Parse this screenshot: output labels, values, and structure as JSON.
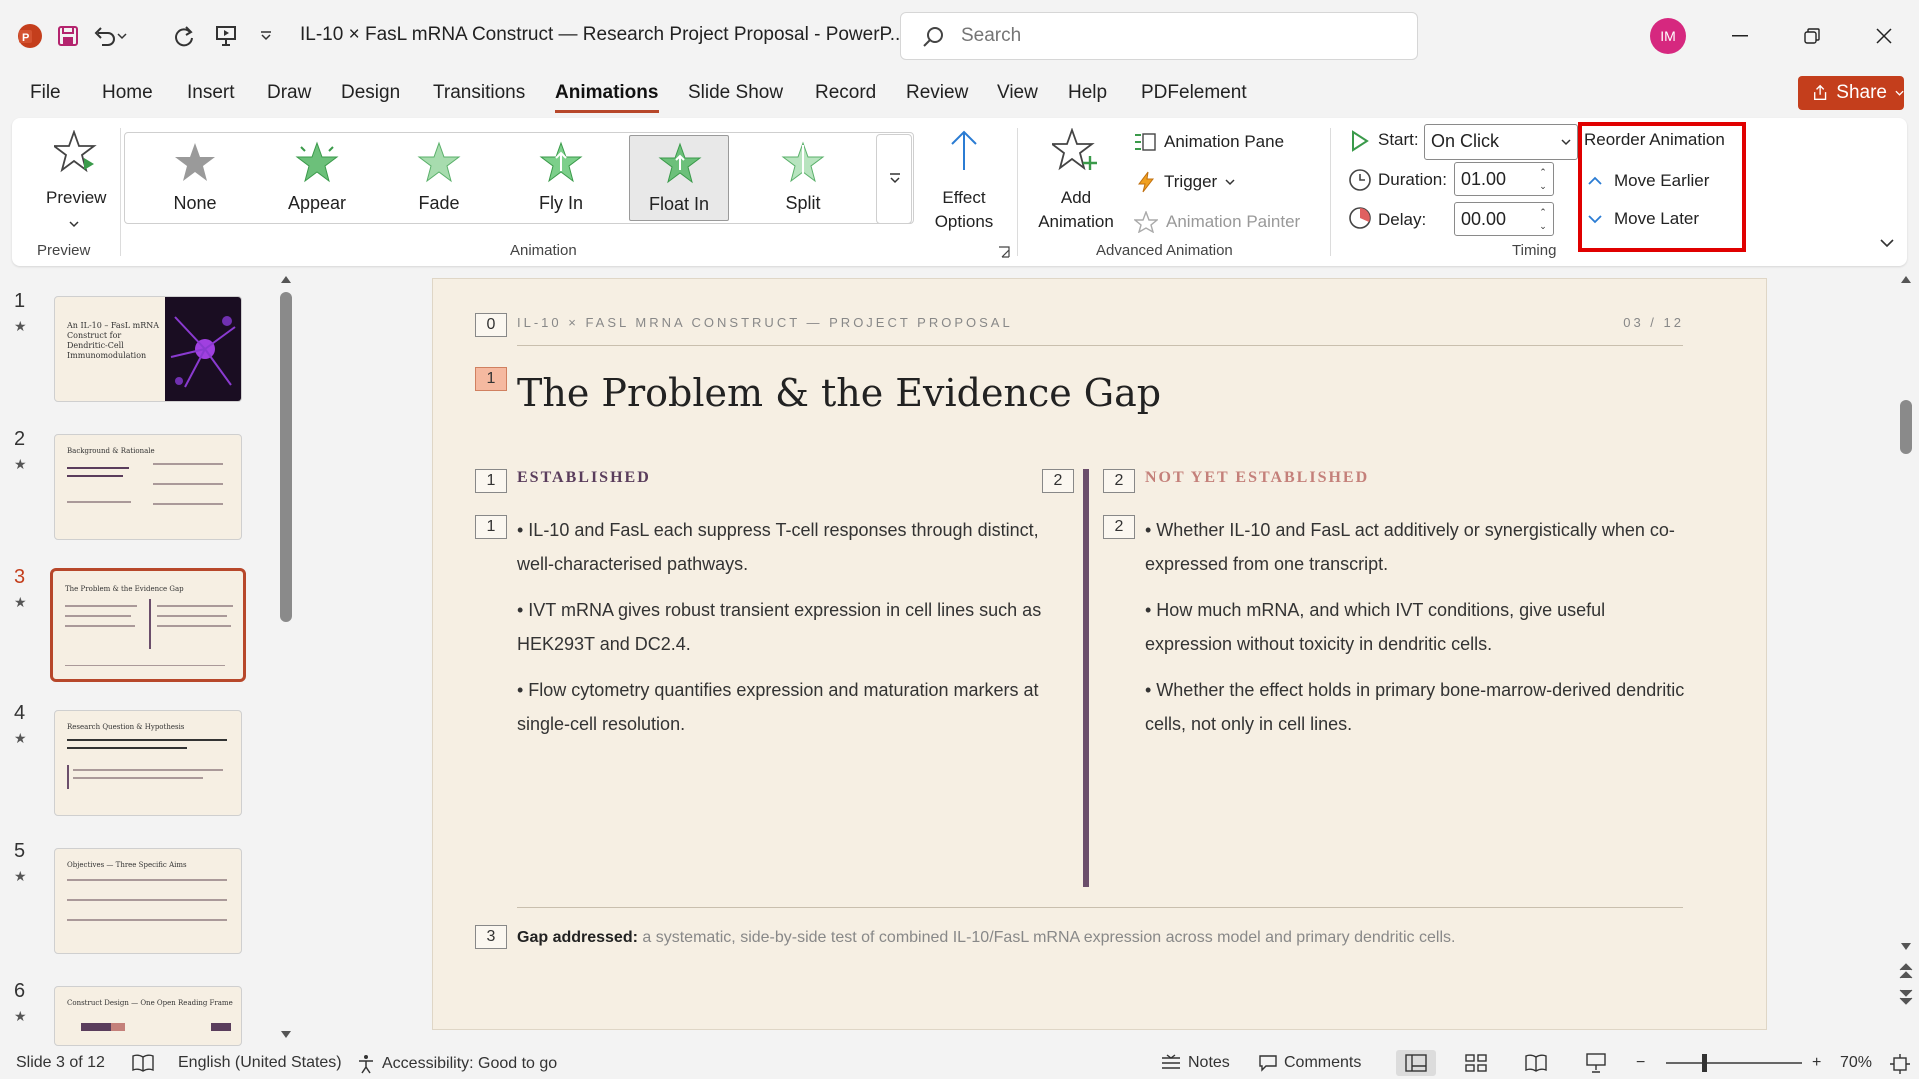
{
  "titlebar": {
    "doc_title": "IL-10 × FasL mRNA Construct — Research Project Proposal  -  PowerP...",
    "search_placeholder": "Search",
    "avatar_initials": "IM"
  },
  "menu": {
    "tabs": [
      "File",
      "Home",
      "Insert",
      "Draw",
      "Design",
      "Transitions",
      "Animations",
      "Slide Show",
      "Record",
      "Review",
      "View",
      "Help",
      "PDFelement"
    ],
    "active": "Animations",
    "share_label": "Share"
  },
  "ribbon": {
    "preview_label": "Preview",
    "preview_group": "Preview",
    "animations": [
      "None",
      "Appear",
      "Fade",
      "Fly In",
      "Float In",
      "Split"
    ],
    "selected_animation": "Float In",
    "effect_options_label": "Effect Options",
    "animation_group": "Animation",
    "add_animation_label": "Add Animation",
    "animation_pane_label": "Animation Pane",
    "trigger_label": "Trigger",
    "animation_painter_label": "Animation Painter",
    "advanced_group": "Advanced Animation",
    "start_label": "Start:",
    "start_value": "On Click",
    "duration_label": "Duration:",
    "duration_value": "01.00",
    "delay_label": "Delay:",
    "delay_value": "00.00",
    "timing_group": "Timing",
    "reorder_title": "Reorder Animation",
    "move_earlier": "Move Earlier",
    "move_later": "Move Later",
    "highlight_color": "#e00000"
  },
  "thumbnails": [
    {
      "num": "1",
      "title": "An IL-10 – FasL mRNA Construct for Dendritic-Cell Immunomodulation"
    },
    {
      "num": "2",
      "title": "Background & Rationale"
    },
    {
      "num": "3",
      "title": "The Problem & the Evidence Gap"
    },
    {
      "num": "4",
      "title": "Research Question & Hypothesis"
    },
    {
      "num": "5",
      "title": "Objectives — Three Specific Aims"
    },
    {
      "num": "6",
      "title": "Construct Design — One Open Reading Frame"
    }
  ],
  "active_slide": "3",
  "slide": {
    "kicker": "IL-10 × FASL MRNA CONSTRUCT — PROJECT PROPOSAL",
    "pager": "03 / 12",
    "title": "The Problem & the Evidence Gap",
    "tag_kicker": "0",
    "tag_title": "1",
    "left": {
      "tag_head": "1",
      "tag_body": "1",
      "heading": "ESTABLISHED",
      "bullets": [
        "• IL-10 and FasL each suppress T-cell responses through distinct, well-characterised pathways.",
        "• IVT mRNA gives robust transient expression in cell lines such as HEK293T and DC2.4.",
        "• Flow cytometry quantifies expression and maturation markers at single-cell resolution."
      ]
    },
    "right": {
      "tag_divider": "2",
      "tag_head": "2",
      "tag_body": "2",
      "heading": "NOT YET ESTABLISHED",
      "bullets": [
        "• Whether IL-10 and FasL act additively or synergistically when co-expressed from one transcript.",
        "• How much mRNA, and which IVT conditions, give useful expression without toxicity in dendritic cells.",
        "• Whether the effect holds in primary bone-marrow-derived dendritic cells, not only in cell lines."
      ]
    },
    "gap": {
      "tag": "3",
      "label": "Gap addressed:",
      "text": " a systematic, side-by-side test of combined IL-10/FasL mRNA expression across model and primary dendritic cells."
    },
    "colors": {
      "established": "#5a3d5c",
      "not_established": "#c4807a",
      "divider": "#6b4e6b"
    }
  },
  "status": {
    "slide_info": "Slide 3 of 12",
    "language": "English (United States)",
    "accessibility": "Accessibility: Good to go",
    "notes": "Notes",
    "comments": "Comments",
    "zoom": "70%"
  }
}
